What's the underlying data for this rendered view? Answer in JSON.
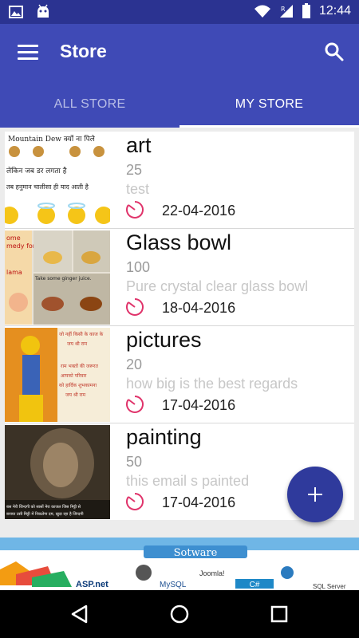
{
  "status_bar": {
    "time": "12:44"
  },
  "app_bar": {
    "title": "Store"
  },
  "tabs": [
    {
      "label": "ALL STORE",
      "active": false
    },
    {
      "label": "MY STORE",
      "active": true
    }
  ],
  "items": [
    {
      "name": "art",
      "count": "25",
      "description": "test",
      "date": "22-04-2016"
    },
    {
      "name": "Glass bowl",
      "count": "100",
      "description": "Pure crystal clear glass bowl",
      "date": "18-04-2016"
    },
    {
      "name": "pictures",
      "count": "20",
      "description": "how big is the best regards",
      "date": "17-04-2016"
    },
    {
      "name": "painting",
      "count": "50",
      "description": "this email s painted",
      "date": "17-04-2016"
    }
  ],
  "thumbnails": [
    {
      "text_lines": [
        "Mountain Dew क्यों ना पिले",
        "लेकिन जब डर लगता है",
        "तब हनुमान चालीसा ही याद आती है"
      ]
    },
    {
      "text_lines": [
        "ome",
        "medy for",
        "lama",
        "Take some ginger juice."
      ]
    },
    {
      "text_lines": [
        "जो नहीं किसी के काज के",
        "जय श्री राम",
        "राम भक्तों की जरूरत",
        "आपको परिवार",
        "को हार्दिक शुभकामना",
        "जय श्री राम"
      ]
    },
    {
      "text_lines": [
        "बस मेरी जिन्दगी को सासों मेरा काजल जिस मिट्टी से",
        "बनाया उसी मिट्टी में निकलेगा दम, खुदा रहा है जिन्दगी"
      ]
    }
  ],
  "banner": {
    "heading": "Sotware",
    "labels": [
      "ASP.net",
      "MySQL",
      "Joomla!",
      "C#",
      "SQL Server"
    ]
  },
  "colors": {
    "primary": "#3f4ab6",
    "primary_dark": "#2b3391",
    "accent": "#2f3a9c",
    "clock": "#e0346b"
  },
  "icons": [
    "image-icon",
    "android-icon",
    "wifi-icon",
    "signal-icon",
    "battery-icon",
    "menu-icon",
    "search-icon",
    "clock-icon",
    "add-icon",
    "back-icon",
    "home-icon",
    "recents-icon"
  ]
}
